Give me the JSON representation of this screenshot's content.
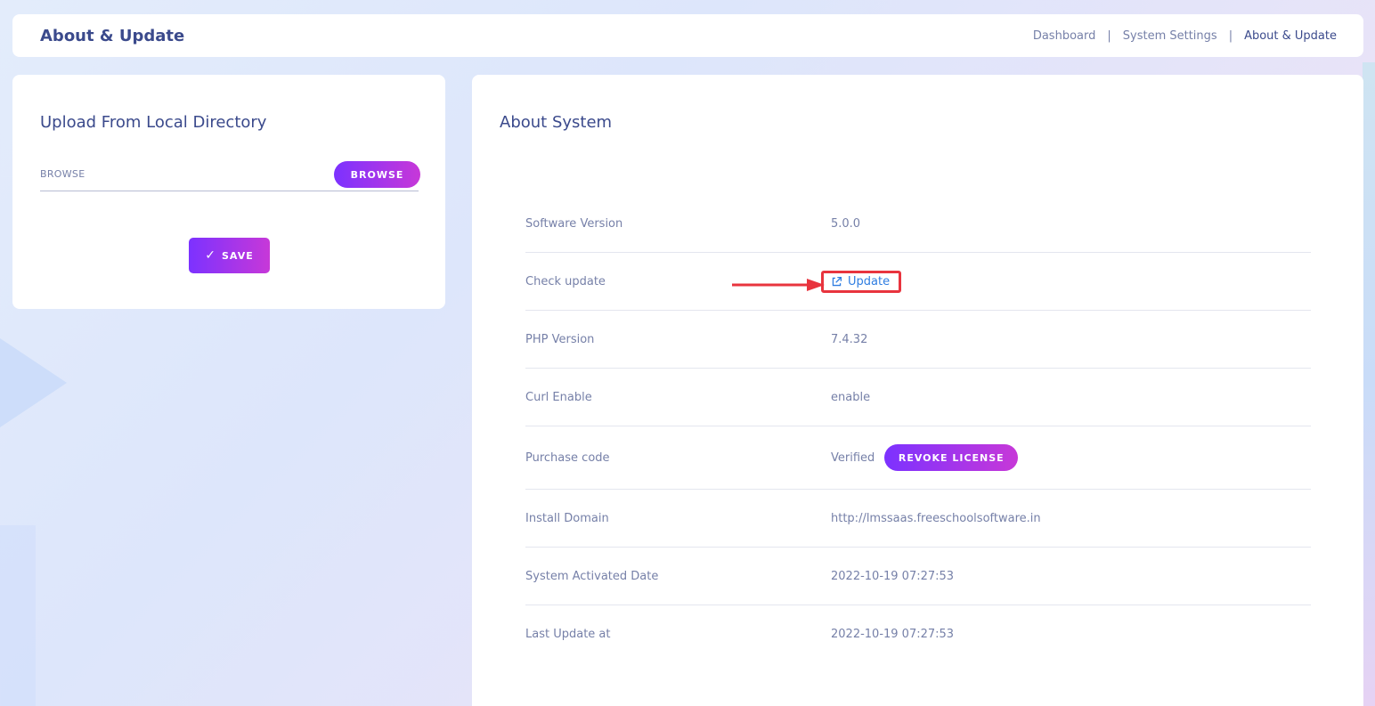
{
  "header": {
    "title": "About & Update",
    "breadcrumb": [
      "Dashboard",
      "System Settings",
      "About & Update"
    ],
    "separator": "|"
  },
  "upload": {
    "title": "Upload From Local Directory",
    "browse_label": "BROWSE",
    "browse_button": "BROWSE",
    "save_check": "✓",
    "save_button": "SAVE"
  },
  "about": {
    "title": "About System",
    "rows": [
      {
        "label": "Software Version",
        "value": "5.0.0"
      },
      {
        "label": "Check update",
        "value": "Update"
      },
      {
        "label": "PHP Version",
        "value": "7.4.32"
      },
      {
        "label": "Curl Enable",
        "value": "enable"
      },
      {
        "label": "Purchase code",
        "value": "Verified",
        "button": "REVOKE LICENSE"
      },
      {
        "label": "Install Domain",
        "value": "http://lmssaas.freeschoolsoftware.in"
      },
      {
        "label": "System Activated Date",
        "value": "2022-10-19 07:27:53"
      },
      {
        "label": "Last Update at",
        "value": "2022-10-19 07:27:53"
      }
    ]
  },
  "colors": {
    "accent_gradient_start": "#7c32ff",
    "accent_gradient_end": "#c738d8",
    "link": "#2f7de1",
    "highlight": "#e8343e",
    "title": "#3b4a8c"
  },
  "icons": {
    "update": "external-link-icon",
    "annotation": "arrow-right-icon"
  }
}
